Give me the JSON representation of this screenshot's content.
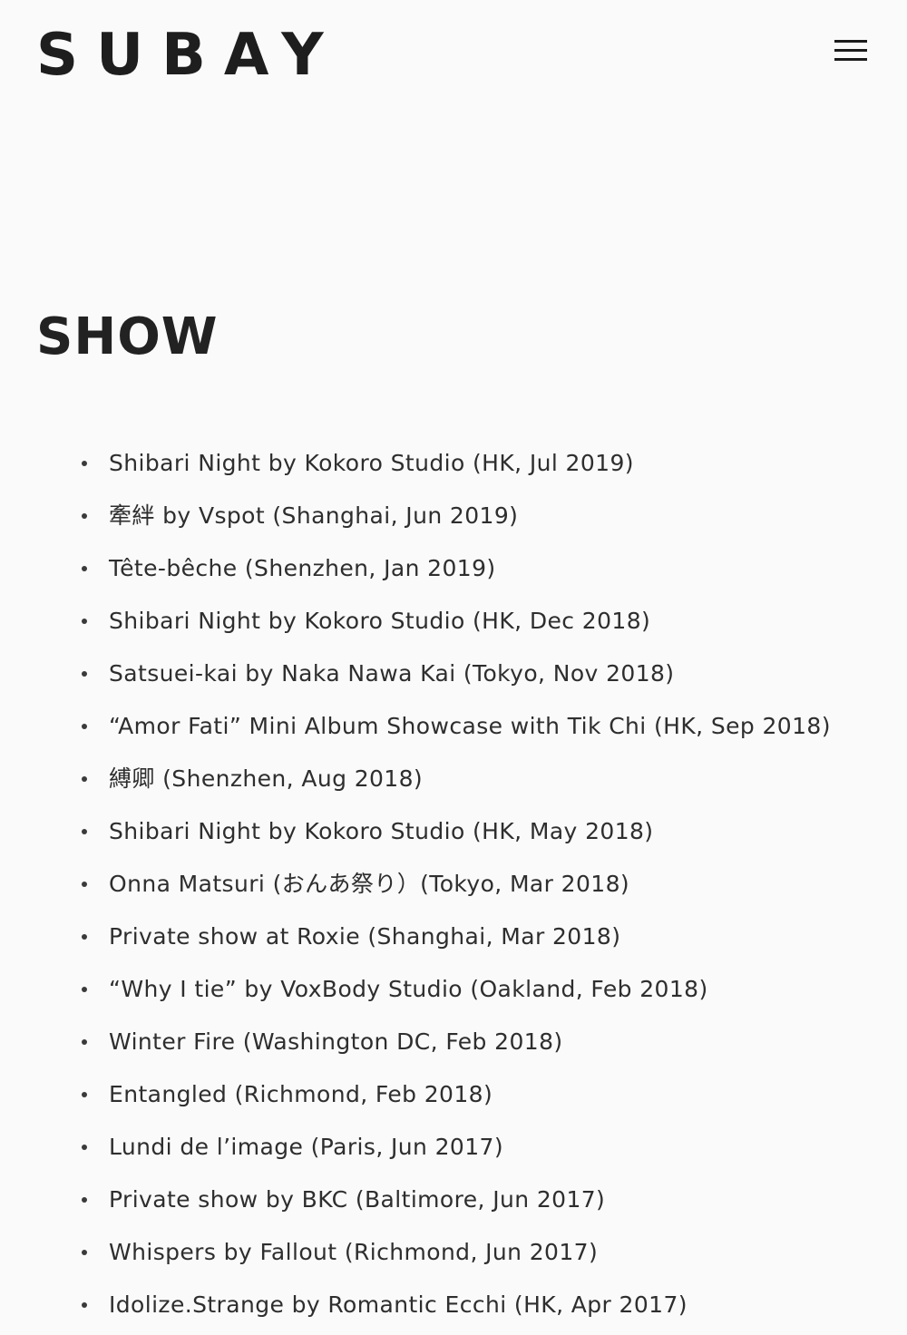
{
  "header": {
    "logo": "SUBAY",
    "menu_icon": "hamburger-menu-icon"
  },
  "main": {
    "title": "SHOW",
    "shows": [
      "Shibari Night by Kokoro Studio (HK, Jul 2019)",
      "牽絆 by Vspot (Shanghai, Jun 2019)",
      "Tête-bêche (Shenzhen, Jan 2019)",
      "Shibari Night by Kokoro Studio (HK, Dec 2018)",
      "Satsuei-kai by Naka Nawa Kai (Tokyo, Nov 2018)",
      "“Amor Fati” Mini Album Showcase with Tik Chi (HK, Sep 2018)",
      "縛卿 (Shenzhen, Aug 2018)",
      "Shibari Night by Kokoro Studio (HK, May 2018)",
      "Onna Matsuri (おんあ祭り）(Tokyo, Mar 2018)",
      "Private show at Roxie (Shanghai, Mar 2018)",
      "“Why I tie” by VoxBody Studio (Oakland, Feb 2018)",
      "Winter Fire (Washington DC, Feb 2018)",
      "Entangled (Richmond, Feb 2018)",
      "Lundi de l’image (Paris, Jun 2017)",
      "Private show by BKC (Baltimore, Jun 2017)",
      "Whispers by Fallout (Richmond, Jun 2017)",
      "Idolize.Strange by Romantic Ecchi (HK, Apr 2017)"
    ]
  }
}
